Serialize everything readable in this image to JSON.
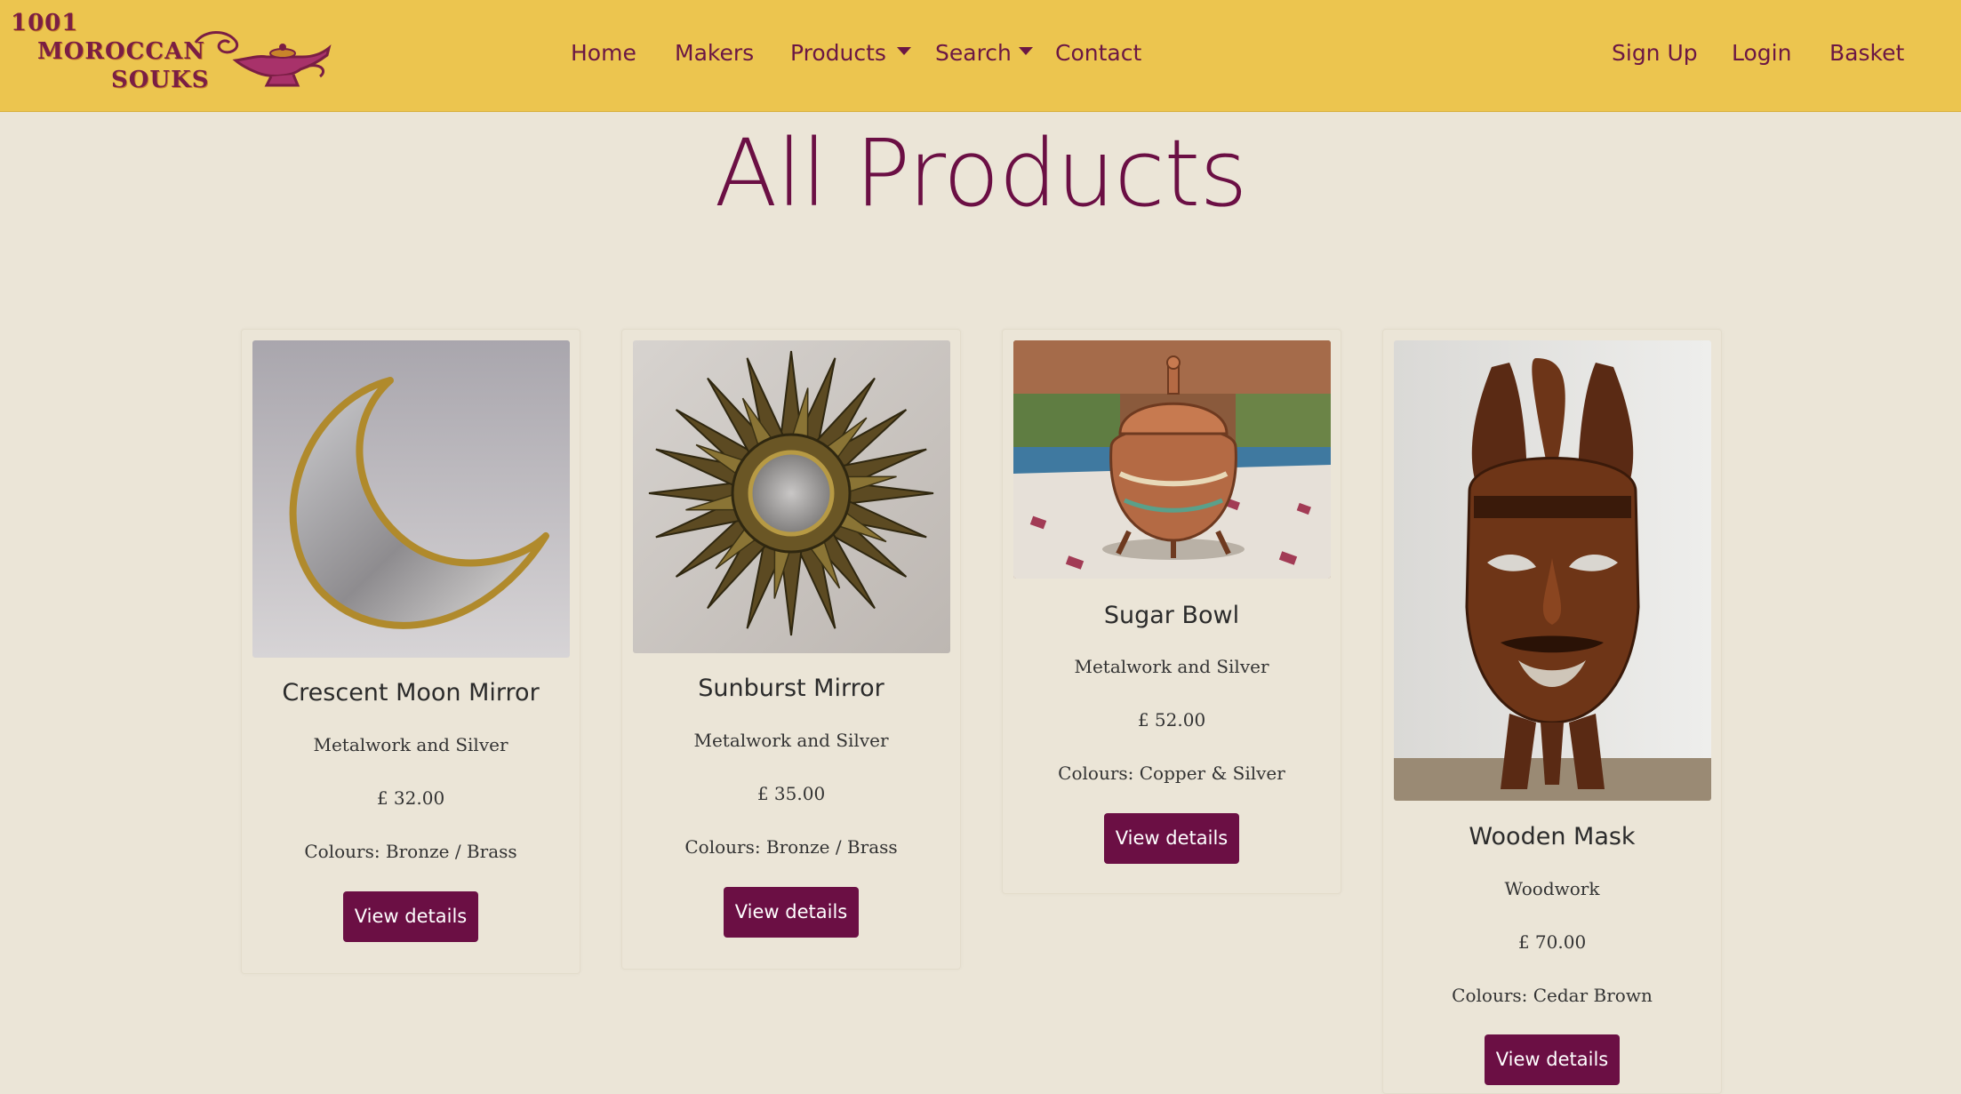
{
  "brand": {
    "logo_line1": "1001",
    "logo_line2": "MOROCCAN",
    "logo_line3": "SOUKS",
    "colors": {
      "navbar": "#ecc54f",
      "accent": "#6b0f44",
      "background": "#ebe5d7"
    },
    "logo_icon": "magic-lamp-icon"
  },
  "nav": {
    "home": "Home",
    "makers": "Makers",
    "products": "Products",
    "search": "Search",
    "contact": "Contact",
    "signup": "Sign Up",
    "login": "Login",
    "basket": "Basket"
  },
  "page": {
    "title": "All Products"
  },
  "products": [
    {
      "name": "Crescent Moon Mirror",
      "category": "Metalwork and Silver",
      "price": "£ 32.00",
      "colours": "Colours: Bronze / Brass",
      "button": "View details"
    },
    {
      "name": "Sunburst Mirror",
      "category": "Metalwork and Silver",
      "price": "£ 35.00",
      "colours": "Colours: Bronze / Brass",
      "button": "View details"
    },
    {
      "name": "Sugar Bowl",
      "category": "Metalwork and Silver",
      "price": "£ 52.00",
      "colours": "Colours: Copper & Silver",
      "button": "View details"
    },
    {
      "name": "Wooden Mask",
      "category": "Woodwork",
      "price": "£ 70.00",
      "colours": "Colours: Cedar Brown",
      "button": "View details"
    }
  ]
}
